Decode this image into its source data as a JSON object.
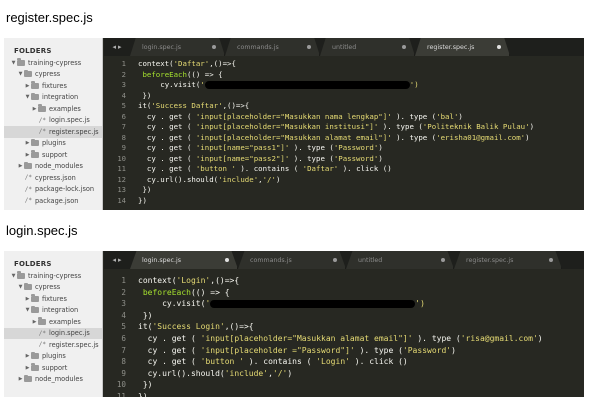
{
  "captions": {
    "first": "register.spec.js",
    "second": "login.spec.js"
  },
  "sidebar": {
    "title": "FOLDERS",
    "items_a": [
      {
        "label": "training-cypress",
        "type": "folder",
        "open": true,
        "depth": 0
      },
      {
        "label": "cypress",
        "type": "folder",
        "open": true,
        "depth": 1
      },
      {
        "label": "fixtures",
        "type": "folder",
        "open": false,
        "depth": 2
      },
      {
        "label": "integration",
        "type": "folder",
        "open": true,
        "depth": 2
      },
      {
        "label": "examples",
        "type": "folder",
        "open": false,
        "depth": 3
      },
      {
        "label": "login.spec.js",
        "type": "file",
        "depth": 3
      },
      {
        "label": "register.spec.js",
        "type": "file",
        "depth": 3,
        "active": true
      },
      {
        "label": "plugins",
        "type": "folder",
        "open": false,
        "depth": 2
      },
      {
        "label": "support",
        "type": "folder",
        "open": false,
        "depth": 2
      },
      {
        "label": "node_modules",
        "type": "folder",
        "open": false,
        "depth": 1
      },
      {
        "label": "cypress.json",
        "type": "file",
        "depth": 1
      },
      {
        "label": "package-lock.json",
        "type": "file",
        "depth": 1
      },
      {
        "label": "package.json",
        "type": "file",
        "depth": 1
      }
    ],
    "items_b": [
      {
        "label": "training-cypress",
        "type": "folder",
        "open": true,
        "depth": 0
      },
      {
        "label": "cypress",
        "type": "folder",
        "open": true,
        "depth": 1
      },
      {
        "label": "fixtures",
        "type": "folder",
        "open": false,
        "depth": 2
      },
      {
        "label": "integration",
        "type": "folder",
        "open": true,
        "depth": 2
      },
      {
        "label": "examples",
        "type": "folder",
        "open": false,
        "depth": 3
      },
      {
        "label": "login.spec.js",
        "type": "file",
        "depth": 3,
        "active": true
      },
      {
        "label": "register.spec.js",
        "type": "file",
        "depth": 3
      },
      {
        "label": "plugins",
        "type": "folder",
        "open": false,
        "depth": 2
      },
      {
        "label": "support",
        "type": "folder",
        "open": false,
        "depth": 2
      },
      {
        "label": "node_modules",
        "type": "folder",
        "open": false,
        "depth": 1
      }
    ]
  },
  "tabs_a": [
    {
      "label": "login.spec.js",
      "active": false
    },
    {
      "label": "commands.js",
      "active": false
    },
    {
      "label": "untitled",
      "active": false
    },
    {
      "label": "register.spec.js",
      "active": true
    }
  ],
  "tabs_b": [
    {
      "label": "login.spec.js",
      "active": true
    },
    {
      "label": "commands.js",
      "active": false
    },
    {
      "label": "untitled",
      "active": false
    },
    {
      "label": "register.spec.js",
      "active": false
    }
  ],
  "code_a": [
    [
      [
        "context(",
        "p"
      ],
      [
        "'Daftar'",
        "s"
      ],
      [
        ",()=>{",
        "p"
      ]
    ],
    [
      [
        " beforeEach",
        "f"
      ],
      [
        "(() => {",
        "p"
      ]
    ],
    [
      [
        "     cy.visit(",
        "p"
      ],
      [
        "'",
        "s"
      ],
      [
        "__REDACT__",
        "r"
      ],
      [
        "')",
        "s"
      ]
    ],
    [
      [
        " })",
        "p"
      ]
    ],
    [
      [
        "it(",
        "p"
      ],
      [
        "'Success Daftar'",
        "s"
      ],
      [
        ",()=>{",
        "p"
      ]
    ],
    [
      [
        "  cy . get ( ",
        "p"
      ],
      [
        "'input[placeholder=\"Masukkan nama lengkap\"]'",
        "s"
      ],
      [
        " ). type (",
        "p"
      ],
      [
        "'bal'",
        "s"
      ],
      [
        ")",
        "p"
      ]
    ],
    [
      [
        "  cy . get ( ",
        "p"
      ],
      [
        "'input[placeholder=\"Masukkan institusi\"]'",
        "s"
      ],
      [
        " ). type (",
        "p"
      ],
      [
        "'Politeknik Balik Pulau'",
        "s"
      ],
      [
        ")",
        "p"
      ]
    ],
    [
      [
        "  cy . get ( ",
        "p"
      ],
      [
        "'input[placeholder=\"Masukkan alamat email\"]'",
        "s"
      ],
      [
        " ). type (",
        "p"
      ],
      [
        "'erisha01@gmail.com'",
        "s"
      ],
      [
        ")",
        "p"
      ]
    ],
    [
      [
        "  cy . get ( ",
        "p"
      ],
      [
        "'input[name=\"pass1\"]'",
        "s"
      ],
      [
        " ). type (",
        "p"
      ],
      [
        "'Password'",
        "s"
      ],
      [
        ")",
        "p"
      ]
    ],
    [
      [
        "  cy . get ( ",
        "p"
      ],
      [
        "'input[name=\"pass2\"]'",
        "s"
      ],
      [
        " ). type (",
        "p"
      ],
      [
        "'Password'",
        "s"
      ],
      [
        ")",
        "p"
      ]
    ],
    [
      [
        "  cy . get ( ",
        "p"
      ],
      [
        "'button '",
        "s"
      ],
      [
        " ). contains ( ",
        "p"
      ],
      [
        "'Daftar'",
        "s"
      ],
      [
        " ). click ()",
        "p"
      ]
    ],
    [
      [
        "  cy.url().should(",
        "p"
      ],
      [
        "'include'",
        "s"
      ],
      [
        ",",
        "p"
      ],
      [
        "'/'",
        "s"
      ],
      [
        ")",
        "p"
      ]
    ],
    [
      [
        " })",
        "p"
      ]
    ],
    [
      [
        "})",
        "p"
      ]
    ]
  ],
  "code_b": [
    [
      [
        "context(",
        "p"
      ],
      [
        "'Login'",
        "s"
      ],
      [
        ",()=>{",
        "p"
      ]
    ],
    [
      [
        " beforeEach",
        "f"
      ],
      [
        "(() => {",
        "p"
      ]
    ],
    [
      [
        "     cy.visit(",
        "p"
      ],
      [
        "'",
        "s"
      ],
      [
        "__REDACT__",
        "r"
      ],
      [
        "')",
        "s"
      ]
    ],
    [
      [
        " })",
        "p"
      ]
    ],
    [
      [
        "it(",
        "p"
      ],
      [
        "'Success Login'",
        "s"
      ],
      [
        ",()=>{",
        "p"
      ]
    ],
    [
      [
        "  cy . get ( ",
        "p"
      ],
      [
        "'input[placeholder=\"Masukkan alamat email\"]'",
        "s"
      ],
      [
        " ). type (",
        "p"
      ],
      [
        "'risa@gmail.com'",
        "s"
      ],
      [
        ")",
        "p"
      ]
    ],
    [
      [
        "  cy . get ( ",
        "p"
      ],
      [
        "'input[placeholder =\"Password\"]'",
        "s"
      ],
      [
        " ). type (",
        "p"
      ],
      [
        "'Password'",
        "s"
      ],
      [
        ")",
        "p"
      ]
    ],
    [
      [
        "  cy . get ( ",
        "p"
      ],
      [
        "'button '",
        "s"
      ],
      [
        " ). contains ( ",
        "p"
      ],
      [
        "'Login'",
        "s"
      ],
      [
        " ). click ()",
        "p"
      ]
    ],
    [
      [
        "  cy.url().should(",
        "p"
      ],
      [
        "'include'",
        "s"
      ],
      [
        ",",
        "p"
      ],
      [
        "'/'",
        "s"
      ],
      [
        ")",
        "p"
      ]
    ],
    [
      [
        " })",
        "p"
      ]
    ],
    [
      [
        "})",
        "p"
      ]
    ]
  ],
  "colors": {
    "editor_bg": "#272822",
    "plain": "#f8f8f2",
    "string": "#e6db74",
    "function": "#a6e22e",
    "line_number": "#8f908a"
  },
  "icons": {
    "nav": "chevron-left-right-icon",
    "folder": "folder-icon",
    "file": "file-icon",
    "close_dot": "tab-dirty-dot-icon"
  }
}
